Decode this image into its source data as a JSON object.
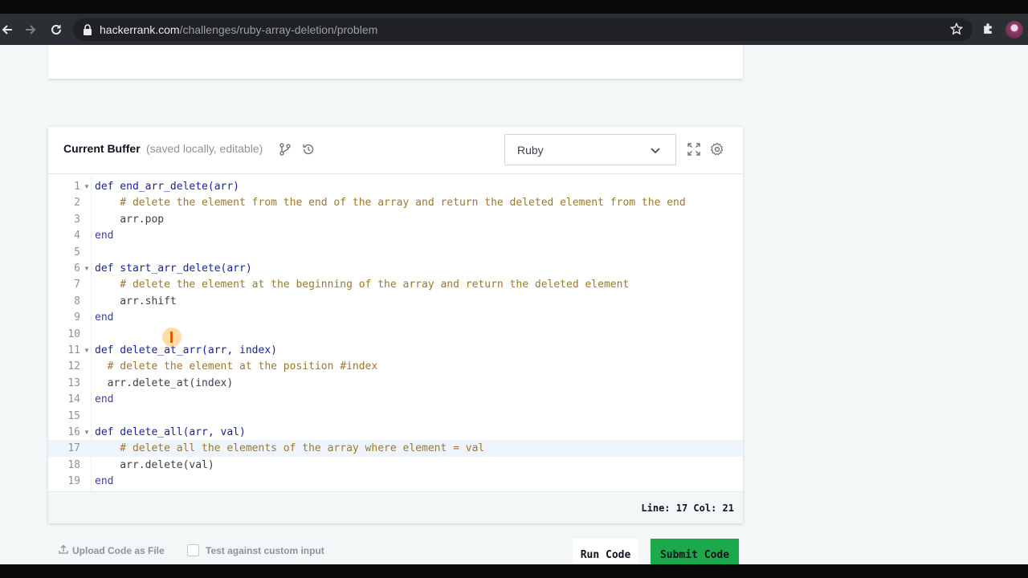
{
  "browser": {
    "url_host": "hackerrank.com",
    "url_path": "/challenges/ruby-array-deletion/problem"
  },
  "editor": {
    "title": "Current Buffer",
    "subtitle": "(saved locally, editable)",
    "language": "Ruby",
    "active_line": 17,
    "lines": [
      {
        "n": "1",
        "fold": true,
        "code": "def end_arr_delete(arr)"
      },
      {
        "n": "2",
        "fold": false,
        "code": "    # delete the element from the end of the array and return the deleted element from the end"
      },
      {
        "n": "3",
        "fold": false,
        "code": "    arr.pop"
      },
      {
        "n": "4",
        "fold": false,
        "code": "end"
      },
      {
        "n": "5",
        "fold": false,
        "code": ""
      },
      {
        "n": "6",
        "fold": true,
        "code": "def start_arr_delete(arr)"
      },
      {
        "n": "7",
        "fold": false,
        "code": "    # delete the element at the beginning of the array and return the deleted element"
      },
      {
        "n": "8",
        "fold": false,
        "code": "    arr.shift"
      },
      {
        "n": "9",
        "fold": false,
        "code": "end"
      },
      {
        "n": "10",
        "fold": false,
        "code": ""
      },
      {
        "n": "11",
        "fold": true,
        "code": "def delete_at_arr(arr, index)"
      },
      {
        "n": "12",
        "fold": false,
        "code": "  # delete the element at the position #index"
      },
      {
        "n": "13",
        "fold": false,
        "code": "  arr.delete_at(index)"
      },
      {
        "n": "14",
        "fold": false,
        "code": "end"
      },
      {
        "n": "15",
        "fold": false,
        "code": ""
      },
      {
        "n": "16",
        "fold": true,
        "code": "def delete_all(arr, val)"
      },
      {
        "n": "17",
        "fold": false,
        "code": "    # delete all the elements of the array where element = val"
      },
      {
        "n": "18",
        "fold": false,
        "code": "    arr.delete(val)"
      },
      {
        "n": "19",
        "fold": false,
        "code": "end"
      }
    ],
    "status": "Line: 17 Col: 21"
  },
  "footer": {
    "upload_label": "Upload Code as File",
    "custom_input_label": "Test against custom input",
    "run_label": "Run Code",
    "submit_label": "Submit Code"
  }
}
